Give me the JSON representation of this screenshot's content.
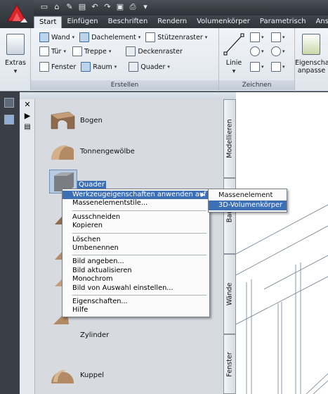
{
  "ribbon": {
    "tabs": [
      "Start",
      "Einfügen",
      "Beschriften",
      "Rendern",
      "Volumenkörper",
      "Parametrisch",
      "Ansicht"
    ],
    "active_tab": "Start",
    "extras_label": "Extras",
    "erstellen": {
      "wand": "Wand",
      "dachelement": "Dachelement",
      "stuetzenraster": "Stützenraster",
      "tuer": "Tür",
      "treppe": "Treppe",
      "deckenraster": "Deckenraster",
      "fenster": "Fenster",
      "raum": "Raum",
      "quader": "Quader",
      "title": "Erstellen"
    },
    "zeichnen": {
      "linie": "Linie",
      "title": "Zeichnen"
    },
    "eigenschaften_label_1": "Eigenscha",
    "eigenschaften_label_2": "anpasse"
  },
  "palette": {
    "tools": [
      "Bogen",
      "Tonnengewölbe",
      "Quader",
      "Zylinder",
      "Kuppel"
    ],
    "tabs": [
      "Modellieren",
      "Bau",
      "Wände",
      "Fenster"
    ]
  },
  "context_menu": {
    "items": [
      {
        "label": "Werkzeugeigenschaften anwenden auf",
        "highlight": true,
        "submenu": true
      },
      {
        "label": "Massenelementstile..."
      },
      {
        "sep": true
      },
      {
        "label": "Ausschneiden"
      },
      {
        "label": "Kopieren"
      },
      {
        "sep": true
      },
      {
        "label": "Löschen"
      },
      {
        "label": "Umbenennen"
      },
      {
        "sep": true
      },
      {
        "label": "Bild angeben..."
      },
      {
        "label": "Bild aktualisieren"
      },
      {
        "label": "Monochrom"
      },
      {
        "label": "Bild von Auswahl einstellen..."
      },
      {
        "sep": true
      },
      {
        "label": "Eigenschaften..."
      },
      {
        "label": "Hilfe"
      }
    ]
  },
  "submenu": {
    "items": [
      "Massenelement",
      "3D-Volumenkörper"
    ],
    "highlighted": "3D-Volumenkörper"
  }
}
